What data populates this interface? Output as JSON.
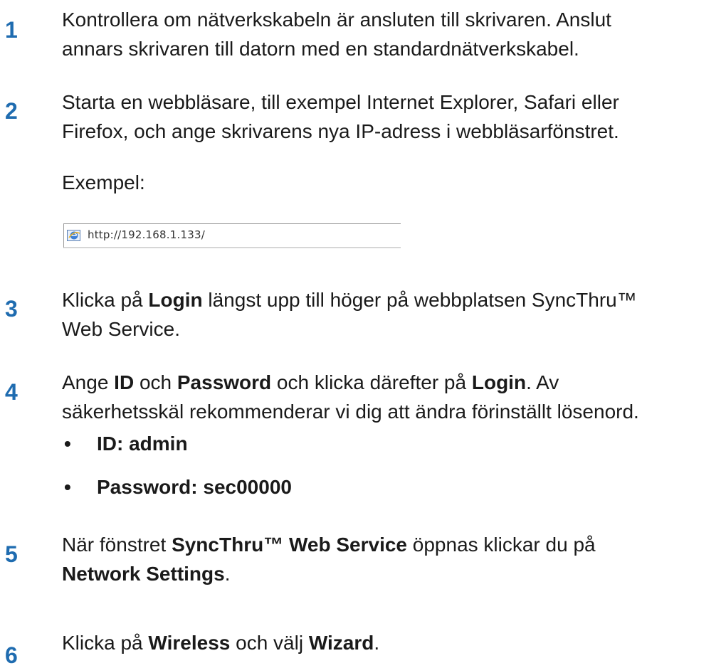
{
  "steps": [
    {
      "number": "1",
      "line1": "Kontrollera om nätverkskabeln är ansluten till skrivaren. Anslut",
      "line2": "annars skrivaren till datorn med en standardnätverkskabel."
    },
    {
      "number": "2",
      "line1": "Starta en webbläsare, till exempel Internet Explorer, Safari eller",
      "line2": "Firefox, och ange skrivarens nya IP-adress i webbläsarfönstret."
    },
    {
      "number": "3",
      "pre": "Klicka på ",
      "login": "Login",
      "post": " längst upp till höger på webbplatsen SyncThru™",
      "line2": "Web Service."
    },
    {
      "number": "4",
      "ange": "Ange ",
      "id": "ID",
      "och": " och ",
      "password": "Password",
      "och_klicka": " och klicka därefter på ",
      "login": "Login",
      "av": ". Av",
      "line2": "säkerhetsskäl rekommenderar vi dig att ändra förinställt lösenord."
    },
    {
      "number": "5",
      "pre": "När fönstret ",
      "syncthru": "SyncThru™ Web Service",
      "post": " öppnas klickar du på",
      "network": "Network Settings",
      "period": "."
    },
    {
      "number": "6",
      "pre": "Klicka på ",
      "wireless": "Wireless",
      "mid": " och välj ",
      "wizard": "Wizard",
      "period": "."
    }
  ],
  "example": {
    "label": "Exempel:",
    "url": "http://192.168.1.133/",
    "icon": "ie-browser-icon"
  },
  "credentials": [
    {
      "bullet": "•",
      "text": "ID: admin"
    },
    {
      "bullet": "•",
      "text": "Password: sec00000"
    }
  ]
}
